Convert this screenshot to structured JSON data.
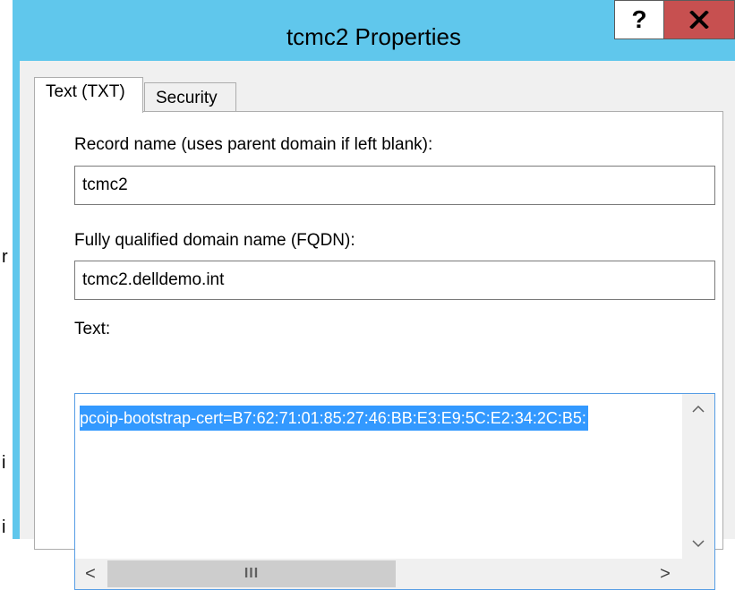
{
  "window": {
    "title": "tcmc2 Properties",
    "help_label": "?",
    "title_bar_color": "#60c7ec",
    "close_button_color": "#c75050"
  },
  "background_glyphs": [
    "r",
    "i",
    "i"
  ],
  "tabs": [
    {
      "label": "Text (TXT)",
      "selected": true
    },
    {
      "label": "Security",
      "selected": false
    }
  ],
  "record_name": {
    "label": "Record name (uses parent domain if left blank):",
    "value": "tcmc2"
  },
  "fqdn": {
    "label": "Fully qualified domain name (FQDN):",
    "value": "tcmc2.delldemo.int"
  },
  "text_field": {
    "label": "Text:",
    "value": "pcoip-bootstrap-cert=B7:62:71:01:85:27:46:BB:E3:E9:5C:E2:34:2C:B5:",
    "selection_color": "#3399ff"
  },
  "scrollbar": {
    "up_icon": "chevron-up-icon",
    "down_icon": "chevron-down-icon",
    "left_glyph": "<",
    "right_glyph": ">",
    "thumb_grip": "III"
  }
}
